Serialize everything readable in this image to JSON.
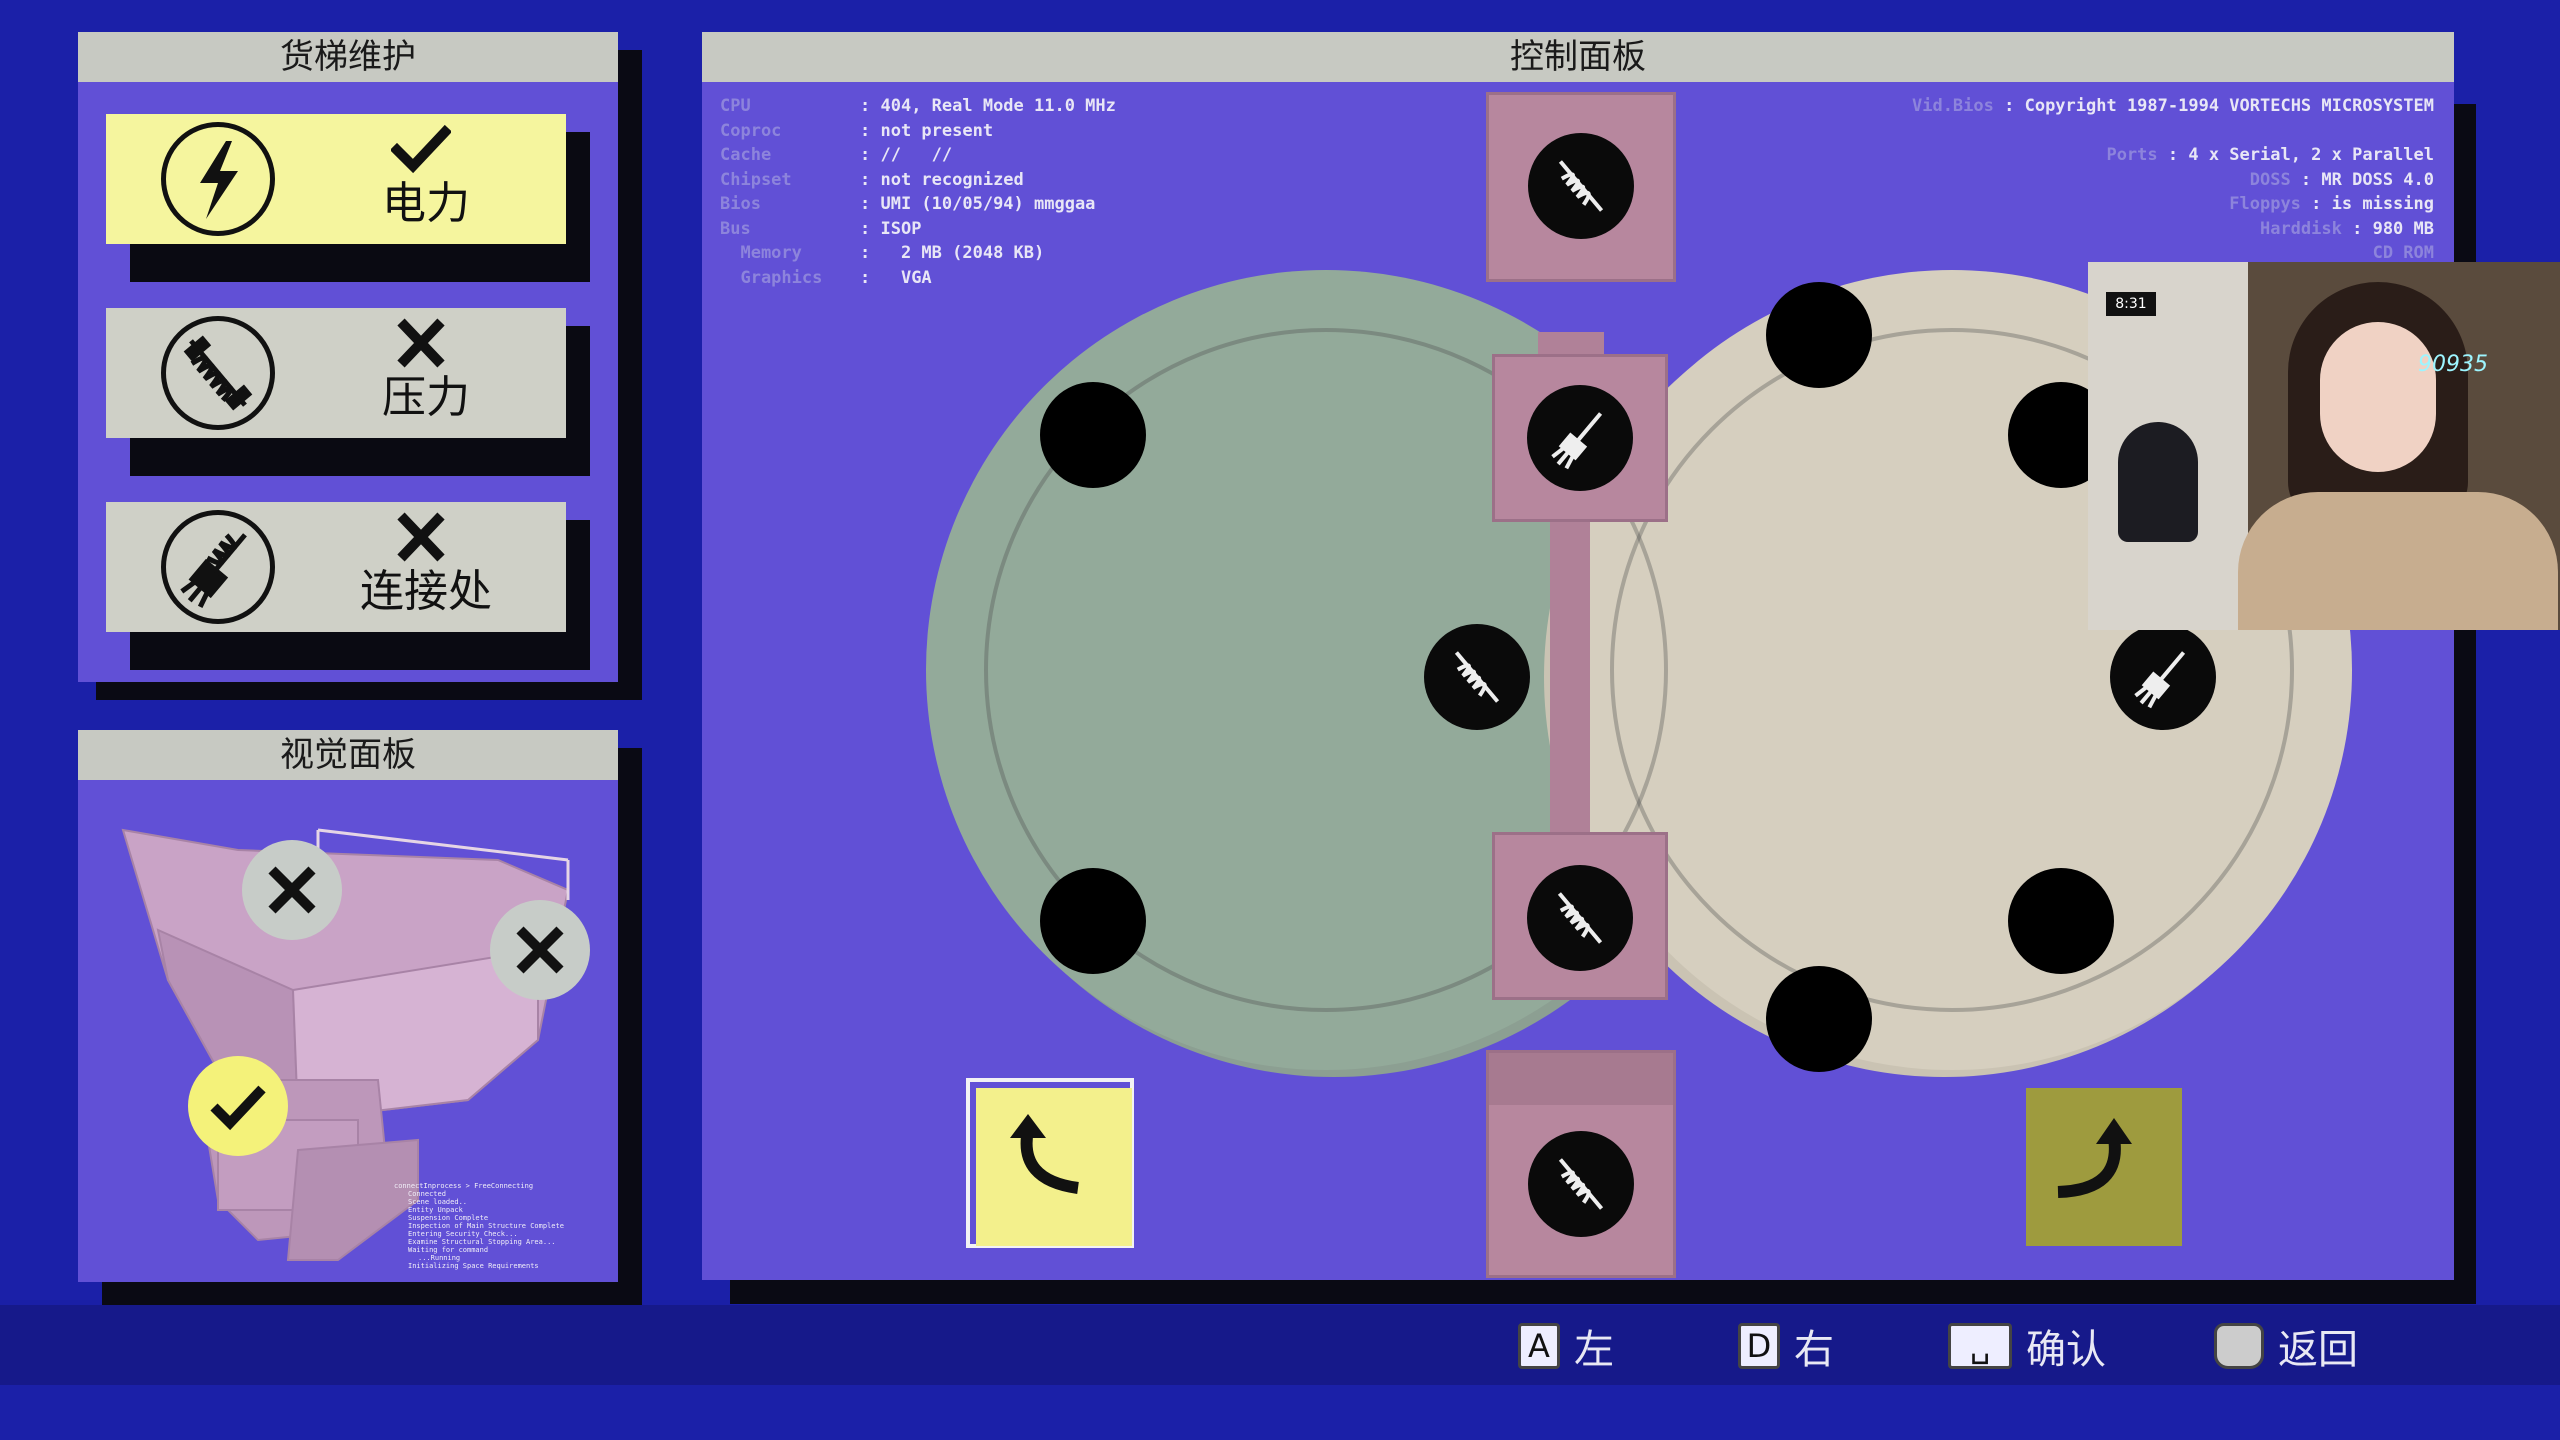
{
  "maintenance_panel": {
    "title": "货梯维护",
    "items": [
      {
        "label": "电力",
        "icon": "lightning-icon",
        "status": "check",
        "active": true
      },
      {
        "label": "压力",
        "icon": "spring-icon",
        "status": "cross",
        "active": false
      },
      {
        "label": "连接处",
        "icon": "connector-icon",
        "status": "cross",
        "active": false
      }
    ]
  },
  "visual_panel": {
    "title": "视觉面板",
    "markers": [
      "cross",
      "cross",
      "check"
    ],
    "log_lines": [
      "connectInprocess > FreeConnecting",
      "Connected",
      "Scene loaded..",
      "Entity Unpack",
      "Suspension Complete",
      "Inspection of Main Structure Complete",
      "Entering Security Check...",
      "Examine Structural Stopping Area...",
      "Waiting for command",
      "...Running",
      "Initializing Space Requirements"
    ]
  },
  "control_panel": {
    "title": "控制面板",
    "sysinfo_left": [
      {
        "key": "CPU",
        "value": "404, Real Mode 11.0 MHz"
      },
      {
        "key": "Coproc",
        "value": "not present"
      },
      {
        "key": "Cache",
        "value": "//   //"
      },
      {
        "key": "Chipset",
        "value": "not recognized"
      },
      {
        "key": "Bios",
        "value": "UMI (10/05/94) mmggaa"
      },
      {
        "key": "Bus",
        "value": "ISOP"
      },
      {
        "key": "  Memory",
        "value": "  2 MB (2048 KB)"
      },
      {
        "key": "  Graphics",
        "value": "  VGA"
      }
    ],
    "sysinfo_right": [
      {
        "key": "Vid.Bios",
        "value": "Copyright 1987-1994 VORTECHS MICROSYSTEM"
      },
      {
        "key": "",
        "value": ""
      },
      {
        "key": "Ports",
        "value": "4 x Serial, 2 x Parallel"
      },
      {
        "key": "DOSS",
        "value": "MR DOSS 4.0"
      },
      {
        "key": "Floppys",
        "value": "is missing"
      },
      {
        "key": "Harddisk",
        "value": "980 MB"
      },
      {
        "key": "CD ROM",
        "value": ""
      }
    ],
    "left_disk_color": "#93aa9a",
    "right_disk_color": "#d6cfbf",
    "rotate_left_icon": "rotate-left-icon",
    "rotate_right_icon": "rotate-right-icon"
  },
  "webcam": {
    "overlay_text": "90935",
    "clock": "8:31"
  },
  "hints": [
    {
      "key": "A",
      "label": "左"
    },
    {
      "key": "D",
      "label": "右"
    },
    {
      "key": "␣",
      "label": "确认"
    },
    {
      "key": "",
      "label": "返回"
    }
  ]
}
